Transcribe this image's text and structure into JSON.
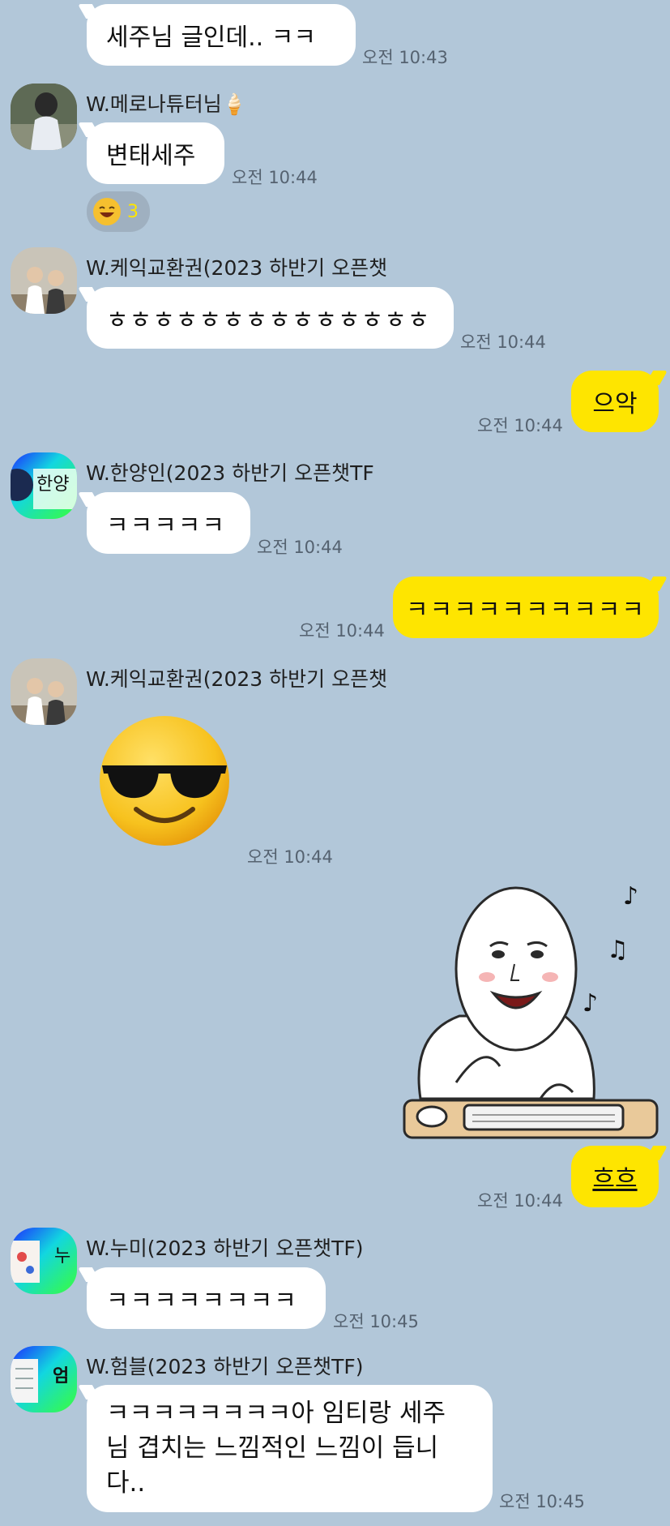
{
  "messages": {
    "m1": {
      "text": "세주님 글인데.. ㅋㅋ",
      "time": "오전 10:43"
    },
    "m2": {
      "sender": "W.메로나튜터님",
      "sender_emoji": "🍦",
      "text": "변태세주",
      "time": "오전 10:44",
      "reaction_count": "3"
    },
    "m3": {
      "sender": "W.케익교환권(2023 하반기 오픈챗",
      "text": "ㅎㅎㅎㅎㅎㅎㅎㅎㅎㅎㅎㅎㅎㅎ",
      "time": "오전 10:44"
    },
    "m4": {
      "text": "으악",
      "time": "오전 10:44"
    },
    "m5": {
      "sender": "W.한양인(2023 하반기 오픈챗TF",
      "avatar_text": "한양",
      "text": "ㅋㅋㅋㅋㅋ",
      "time": "오전 10:44"
    },
    "m6": {
      "text": "ㅋㅋㅋㅋㅋㅋㅋㅋㅋㅋ",
      "time": "오전 10:44"
    },
    "m7": {
      "sender": "W.케익교환권(2023 하반기 오픈챗",
      "time": "오전 10:44"
    },
    "m8": {
      "text": "흐흐",
      "time": "오전 10:44"
    },
    "m9": {
      "sender": "W.누미(2023 하반기 오픈챗TF)",
      "avatar_text": "누",
      "text": "ㅋㅋㅋㅋㅋㅋㅋㅋ",
      "time": "오전 10:45"
    },
    "m10": {
      "sender": "W.험블(2023 하반기 오픈챗TF)",
      "avatar_text": "엄",
      "line1": "ㅋㅋㅋㅋㅋㅋㅋㅋ아 임티랑 세주",
      "line2": "님 겹치는 느낌적인 느낌이 듭니",
      "line3": "다..",
      "time": "오전 10:45"
    }
  },
  "colors": {
    "background": "#b2c7d9",
    "outgoing_bubble": "#fee500",
    "incoming_bubble": "#ffffff"
  }
}
